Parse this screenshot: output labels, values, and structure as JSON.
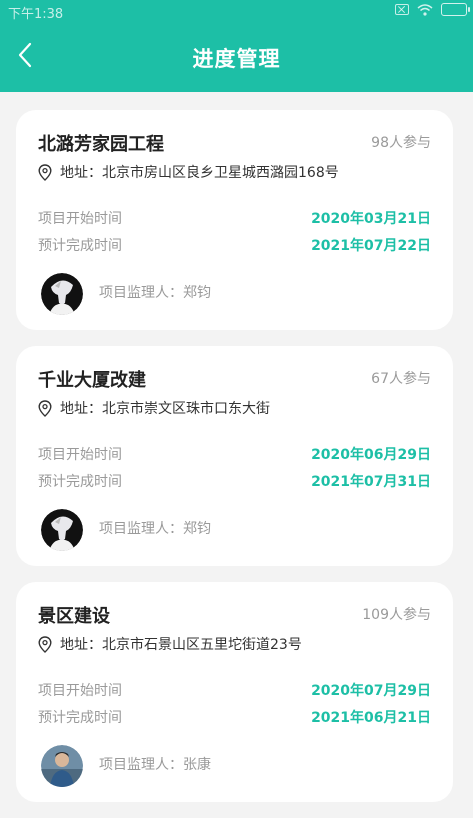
{
  "status_bar": {
    "time": "下午1:38"
  },
  "header": {
    "title": "进度管理"
  },
  "labels": {
    "start": "项目开始时间",
    "end": "预计完成时间",
    "address_prefix": "地址：",
    "supervisor_prefix": "项目监理人："
  },
  "projects": [
    {
      "name": "北潞芳家园工程",
      "participants": "98人参与",
      "address": "地址：北京市房山区良乡卫星城西潞园168号",
      "start": "2020年03月21日",
      "end": "2021年07月22日",
      "supervisor": "项目监理人：郑钧",
      "avatar_icon": "dark-illustration-avatar"
    },
    {
      "name": "千业大厦改建",
      "participants": "67人参与",
      "address": "地址：北京市崇文区珠市口东大街",
      "start": "2020年06月29日",
      "end": "2021年07月31日",
      "supervisor": "项目监理人：郑钧",
      "avatar_icon": "dark-illustration-avatar"
    },
    {
      "name": "景区建设",
      "participants": "109人参与",
      "address": "地址：北京市石景山区五里坨街道23号",
      "start": "2020年07月29日",
      "end": "2021年06月21日",
      "supervisor": "项目监理人：张康",
      "avatar_icon": "photo-person-avatar"
    }
  ],
  "colors": {
    "accent": "#1dbfa6",
    "background": "#f3f3f3"
  }
}
